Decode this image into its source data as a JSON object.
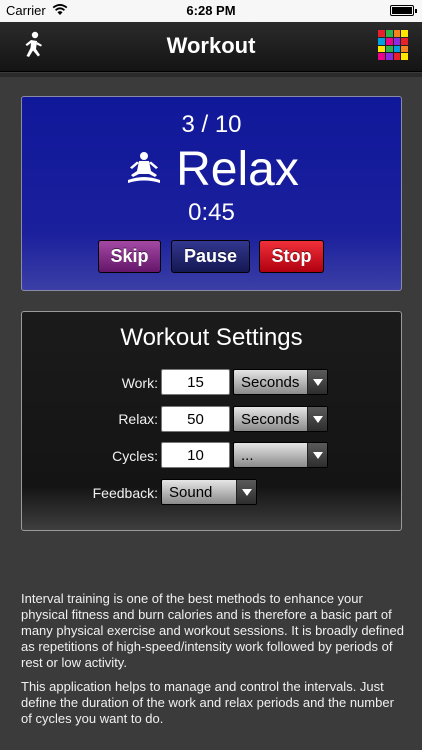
{
  "status_bar": {
    "carrier": "Carrier",
    "time": "6:28 PM"
  },
  "nav": {
    "title": "Workout"
  },
  "workout": {
    "cycle": "3 / 10",
    "phase": "Relax",
    "timer": "0:45",
    "skip_label": "Skip",
    "pause_label": "Pause",
    "stop_label": "Stop"
  },
  "settings": {
    "title": "Workout Settings",
    "work_label": "Work:",
    "work_value": "15",
    "work_unit": "Seconds",
    "relax_label": "Relax:",
    "relax_value": "50",
    "relax_unit": "Seconds",
    "cycles_label": "Cycles:",
    "cycles_value": "10",
    "cycles_unit": "...",
    "feedback_label": "Feedback:",
    "feedback_value": "Sound"
  },
  "intro": {
    "p1": "Interval training is one of the best methods to enhance your physical fitness and burn calories and is therefore a basic part of many physical exercise and workout sessions. It is broadly defined as repetitions of high-speed/intensity work followed by periods of rest or low activity.",
    "p2": "This application helps to manage and control the intervals. Just define the duration of the work and relax periods and the number of cycles you want to do."
  },
  "colors": {
    "panel_blue": "#10189a",
    "skip": "#a349a4",
    "pause": "#33378f",
    "stop": "#e8202c",
    "background": "#3b3b3b"
  },
  "icons": {
    "nav_left": "runner-icon",
    "nav_right": "color-grid-icon",
    "phase": "meditation-icon"
  }
}
